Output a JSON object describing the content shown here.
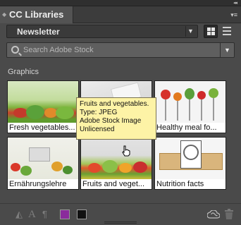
{
  "panel": {
    "title": "CC Libraries",
    "menu_icon": "panel-menu-icon"
  },
  "library": {
    "selected": "Newsletter"
  },
  "search": {
    "placeholder": "Search Adobe Stock"
  },
  "section": {
    "title": "Graphics"
  },
  "graphics": [
    {
      "label": "Fresh vegetables..."
    },
    {
      "label": ""
    },
    {
      "label": "Healthy meal fo..."
    },
    {
      "label": "Ernährungslehre"
    },
    {
      "label": "Fruits and veget..."
    },
    {
      "label": "Nutrition facts"
    }
  ],
  "tooltip": {
    "line1": "Fruits and vegetables.",
    "line2": "Type: JPEG",
    "line3": "Adobe Stock Image",
    "line4": "Unlicensed"
  },
  "footer": {
    "fill_color": "#8a2b9c",
    "stroke_color": "#111111"
  }
}
